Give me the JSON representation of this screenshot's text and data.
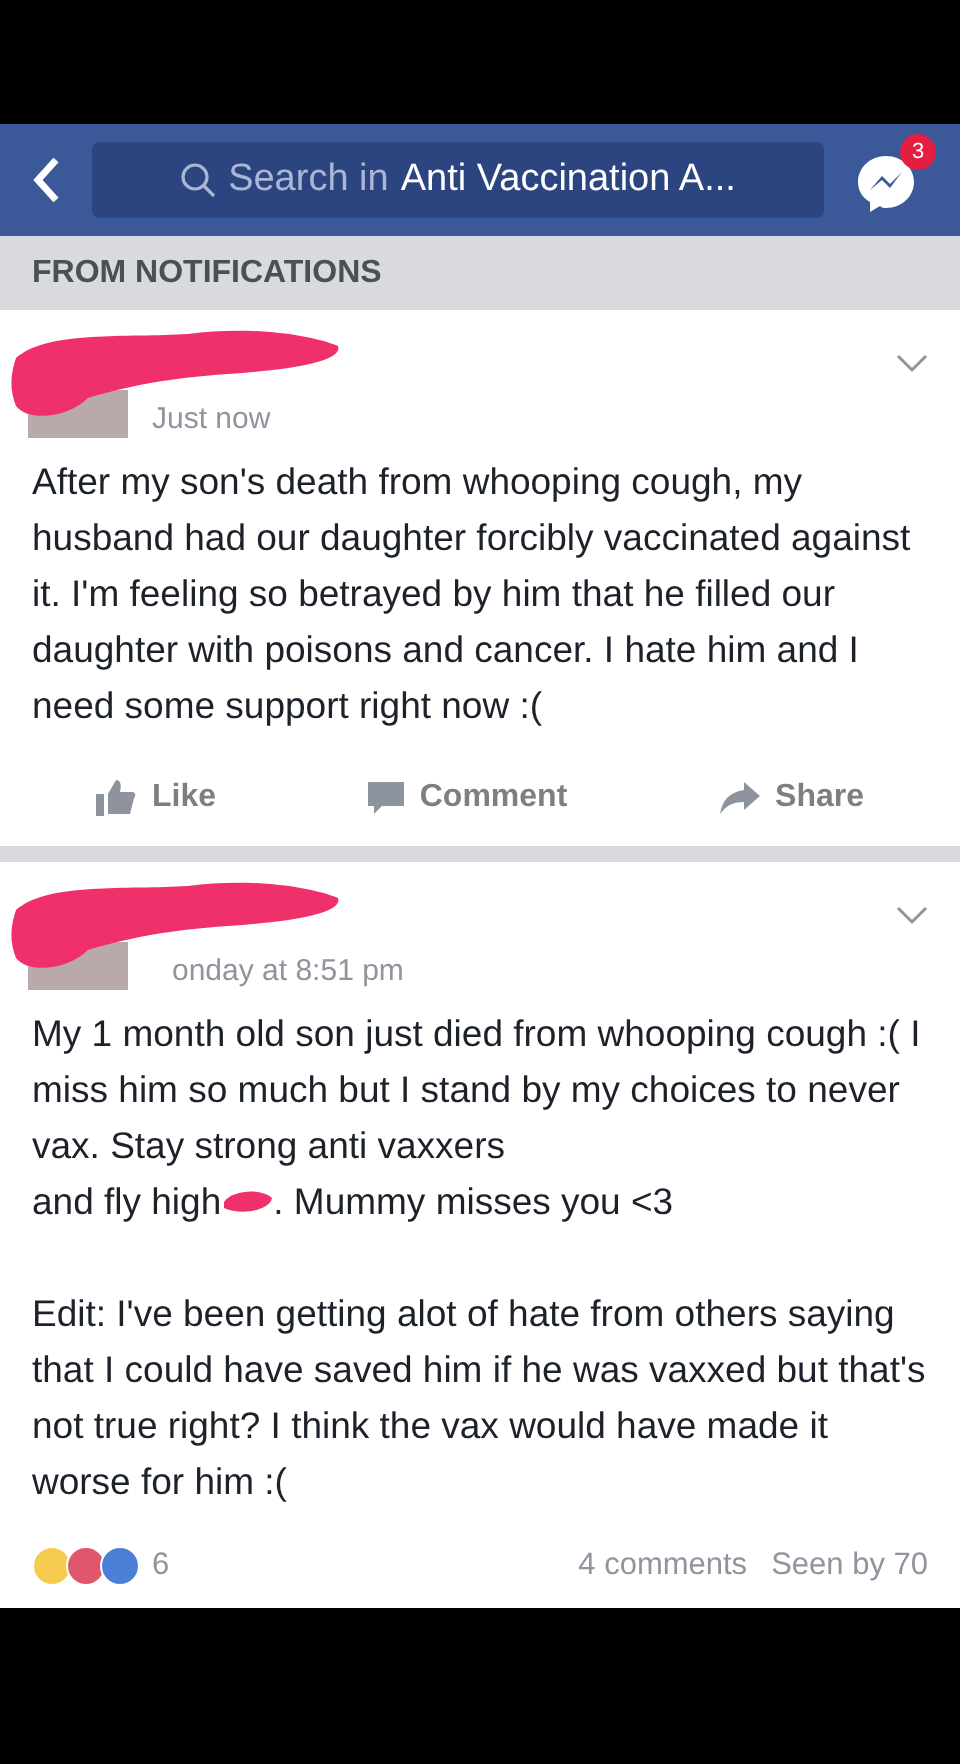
{
  "header": {
    "search_prefix": "Search in",
    "search_group": "Anti Vaccination A...",
    "messenger_badge": "3"
  },
  "section_label": "FROM NOTIFICATIONS",
  "posts": [
    {
      "time": "Just now",
      "body": [
        "After my son's death from whooping cough, my husband had our daughter forcibly vaccinated against it. I'm feeling so betrayed by him that he filled our daughter with poisons and cancer. I hate him and I need some support right now :("
      ],
      "actions": [
        "Like",
        "Comment",
        "Share"
      ]
    },
    {
      "time": "onday at 8:51 pm",
      "body": [
        "My 1 month old son just died from whooping cough :( I miss him so much but I stand by my choices to never vax. Stay strong anti vaxxers",
        "and fly high",
        ". Mummy misses you <3"
      ],
      "edit": "Edit: I've been getting alot of hate from others saying that I could have saved him if he was vaxxed but that's not true right? I think the vax would have made it worse for him :(",
      "reaction_count": "6",
      "comments": "4 comments",
      "seen": "Seen by 70"
    }
  ]
}
